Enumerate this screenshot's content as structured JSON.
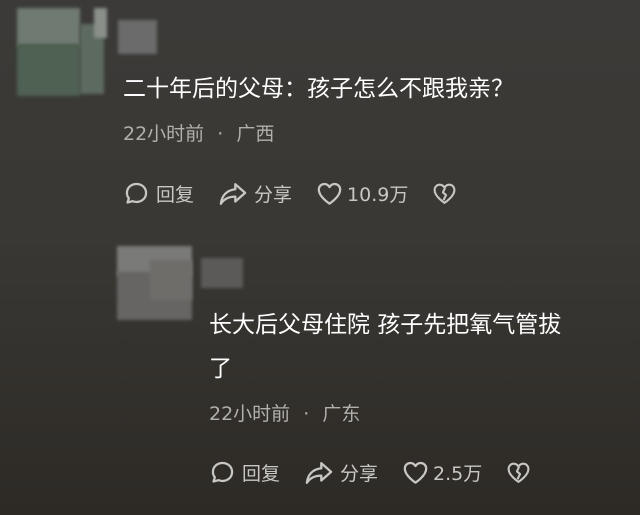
{
  "comments": [
    {
      "text": "二十年后的父母：孩子怎么不跟我亲？",
      "time": "22小时前",
      "region": "广西",
      "reply_label": "回复",
      "share_label": "分享",
      "likes": "10.9万"
    },
    {
      "text_line1": "长大后父母住院 孩子先把氧气管拔",
      "text_line2": "了",
      "time": "22小时前",
      "region": "广东",
      "reply_label": "回复",
      "share_label": "分享",
      "likes": "2.5万"
    }
  ],
  "meta_separator": "·",
  "icons": {
    "reply": "comment-bubble-icon",
    "share": "share-arrow-icon",
    "like": "heart-icon",
    "dislike": "broken-heart-icon"
  }
}
